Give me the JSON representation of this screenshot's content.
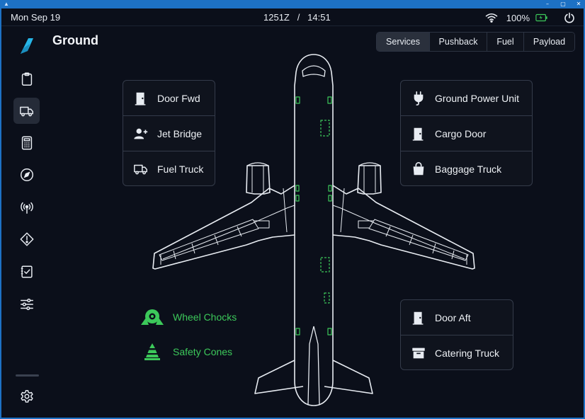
{
  "window": {
    "controls": [
      "–",
      "▢",
      "✕"
    ]
  },
  "status": {
    "date": "Mon Sep 19",
    "time": "1251Z   /   14:51",
    "battery": "100%"
  },
  "page": {
    "title": "Ground"
  },
  "tabs": [
    {
      "label": "Services",
      "active": true
    },
    {
      "label": "Pushback",
      "active": false
    },
    {
      "label": "Fuel",
      "active": false
    },
    {
      "label": "Payload",
      "active": false
    }
  ],
  "sidebar": {
    "items": [
      {
        "icon": "clipboard-icon"
      },
      {
        "icon": "truck-icon",
        "active": true
      },
      {
        "icon": "calculator-icon"
      },
      {
        "icon": "compass-icon"
      },
      {
        "icon": "antenna-icon"
      },
      {
        "icon": "warning-icon"
      },
      {
        "icon": "checklist-icon"
      },
      {
        "icon": "sliders-icon"
      }
    ],
    "bottom": {
      "icon": "gear-icon"
    }
  },
  "services": {
    "left_card": [
      {
        "label": "Door Fwd",
        "icon": "door-icon"
      },
      {
        "label": "Jet Bridge",
        "icon": "person-add-icon"
      },
      {
        "label": "Fuel Truck",
        "icon": "truck-icon"
      }
    ],
    "right_card": [
      {
        "label": "Ground Power Unit",
        "icon": "plug-icon"
      },
      {
        "label": "Cargo Door",
        "icon": "door-icon"
      },
      {
        "label": "Baggage Truck",
        "icon": "bag-icon"
      }
    ],
    "aft_card": [
      {
        "label": "Door Aft",
        "icon": "door-icon"
      },
      {
        "label": "Catering Truck",
        "icon": "box-icon"
      }
    ],
    "ground_items": [
      {
        "label": "Wheel Chocks",
        "icon": "wheel-chocks-icon"
      },
      {
        "label": "Safety Cones",
        "icon": "cone-icon"
      }
    ]
  },
  "colors": {
    "background": "#0b0f1a",
    "accent_active": "#3cc85a",
    "logo": "#26b6e8"
  }
}
